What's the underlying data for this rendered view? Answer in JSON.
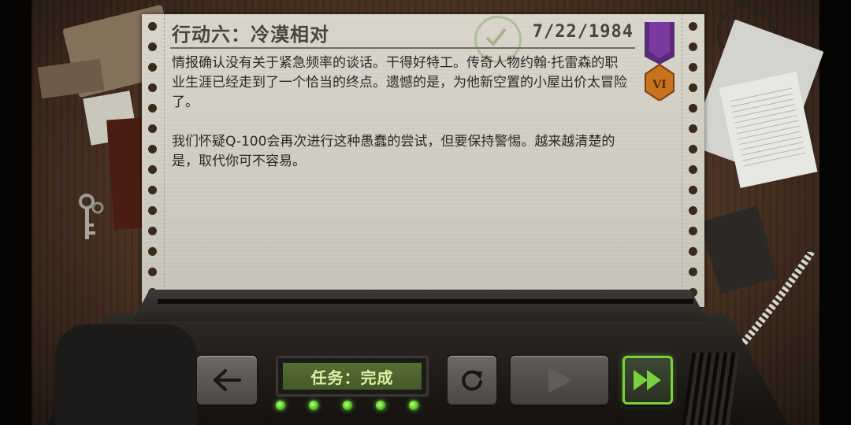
{
  "report": {
    "title": "行动六：冷漠相对",
    "date": "7/22/1984",
    "paragraph1": "情报确认没有关于紧急频率的谈话。干得好特工。传奇人物约翰·托雷森的职业生涯已经走到了一个恰当的终点。遗憾的是，为他新空置的小屋出价太冒险了。",
    "paragraph2": "我们怀疑Q-100会再次进行这种愚蠢的尝试，但要保持警惕。越来越清楚的是，取代你可不容易。"
  },
  "medal": {
    "rank": "VI",
    "ribbon_color": "#5b2a7a",
    "medal_color": "#c8731e"
  },
  "console": {
    "status_label": "任务：完成",
    "back_icon": "left-arrow-icon",
    "replay_icon": "replay-icon",
    "play_icon": "play-icon",
    "fast_forward_icon": "fast-forward-icon",
    "indicator_lights": 5
  },
  "colors": {
    "accent_green": "#7ad13f",
    "paper": "#d9d6cc",
    "status_text": "#d8f3a6"
  }
}
